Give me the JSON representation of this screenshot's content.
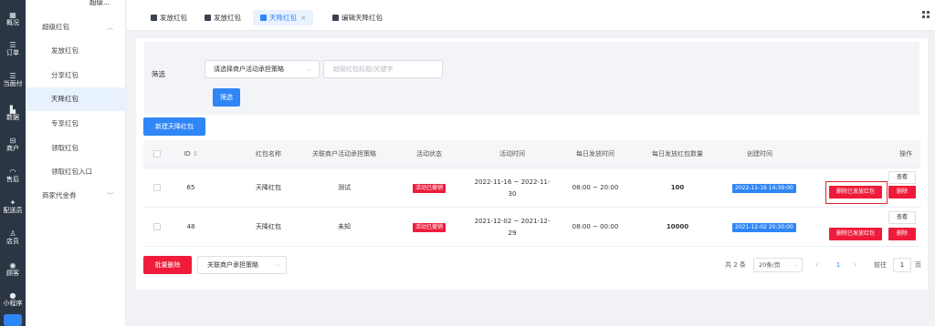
{
  "rail": {
    "items": [
      {
        "icon": "▦",
        "label": "概况"
      },
      {
        "icon": "☰",
        "label": "订单"
      },
      {
        "icon": "☰",
        "label": "当面付"
      },
      {
        "icon": "▙",
        "label": "数据"
      },
      {
        "icon": "⊟",
        "label": "商户"
      },
      {
        "icon": "◠",
        "label": "售后"
      },
      {
        "icon": "✦",
        "label": "配送员"
      },
      {
        "icon": "♙",
        "label": "店员"
      },
      {
        "icon": "◉",
        "label": "顾客"
      },
      {
        "icon": "●",
        "label": "小程序"
      }
    ]
  },
  "submenu": {
    "header": "超级...",
    "group1": "超级红包",
    "items": [
      "发放红包",
      "分享红包",
      "天降红包",
      "专享红包",
      "领取红包",
      "领取红包入口"
    ],
    "group2": "商家代金券"
  },
  "tabs": [
    {
      "label": "发放红包"
    },
    {
      "label": "发放红包"
    },
    {
      "label": "天降红包",
      "close": "×"
    },
    {
      "label": "编辑天降红包"
    }
  ],
  "filter": {
    "label": "筛选",
    "select_value": "请选择商户活动承担策略",
    "search_placeholder": "超级红包标题/关键字",
    "button": "筛选"
  },
  "new_button": "新建天降红包",
  "table": {
    "headers": [
      "ID",
      "红包名称",
      "关联商户活动承担策略",
      "活动状态",
      "活动时间",
      "每日发放时间",
      "每日发放红包数量",
      "创建时间",
      "操作"
    ],
    "sort_glyph": "⇕",
    "rows": [
      {
        "id": "65",
        "name": "天降红包",
        "strategy": "测试",
        "status": "活动已撤销",
        "time_line1": "2022-11-16 ~ 2022-11-",
        "time_line2": "30",
        "daily_time": "08:00 ~ 20:00",
        "daily_count": "100",
        "created": "2022-11-16 14:39:00",
        "action_view": "查看",
        "action_delete_issued": "删除已发放红包",
        "action_delete": "删除"
      },
      {
        "id": "48",
        "name": "天降红包",
        "strategy": "未知",
        "status": "活动已撤销",
        "time_line1": "2021-12-02 ~ 2021-12-",
        "time_line2": "29",
        "daily_time": "08:00 ~ 00:00",
        "daily_count": "10000",
        "created": "2021-12-02 20:30:00",
        "action_view": "查看",
        "action_delete_issued": "删除已发放红包",
        "action_delete": "删除"
      }
    ]
  },
  "footer": {
    "batch_delete": "批量删除",
    "strategy_select": "关联商户承担策略",
    "total": "共 2 条",
    "page_size": "20条/页",
    "prev": "‹",
    "current_page": "1",
    "next": "›",
    "goto_label": "前往",
    "goto_value": "1",
    "page_suffix": "页"
  },
  "colors": {
    "primary": "#2f86f6",
    "danger": "#ee1c3a",
    "rail": "#2b3645"
  }
}
